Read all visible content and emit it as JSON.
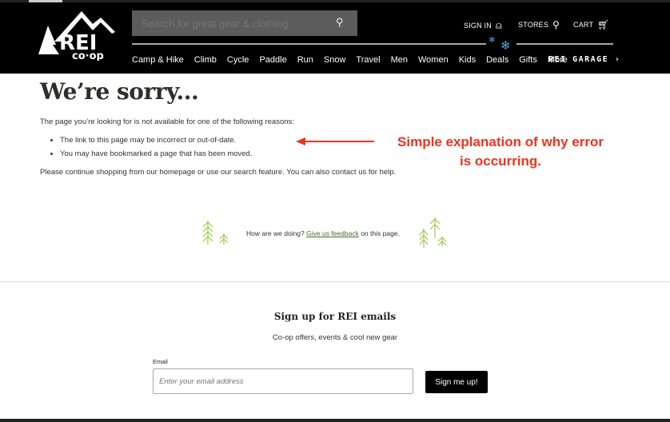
{
  "header": {
    "logo_text": "REI co-op",
    "search_placeholder": "Search for great gear & clothing",
    "sign_in": "SIGN IN",
    "stores": "STORES",
    "cart": "CART",
    "nav": [
      "Camp & Hike",
      "Climb",
      "Cycle",
      "Paddle",
      "Run",
      "Snow",
      "Travel",
      "Men",
      "Women",
      "Kids",
      "Deals",
      "Gifts",
      "More"
    ],
    "garage": "REI GARAGE"
  },
  "main": {
    "title": "We’re sorry...",
    "intro": "The page you’re looking for is not available for one of the following reasons:",
    "reasons": [
      "The link to this page may be incorrect or out-of-date.",
      "You may have bookmarked a page that has been moved."
    ],
    "continue": "Please continue shopping from our homepage or use our search feature. You can also contact us for help."
  },
  "annotation": {
    "line1": "Simple explanation of why error",
    "line2": "is occurring.",
    "color": "#f0321e"
  },
  "feedback": {
    "prefix": "How are we doing?",
    "link": "Give us feedback",
    "suffix": "on this page."
  },
  "signup": {
    "title": "Sign up for REI emails",
    "subtitle": "Co-op offers, events & cool new gear",
    "email_label": "Email",
    "email_placeholder": "Enter your email address",
    "button": "Sign me up!"
  }
}
